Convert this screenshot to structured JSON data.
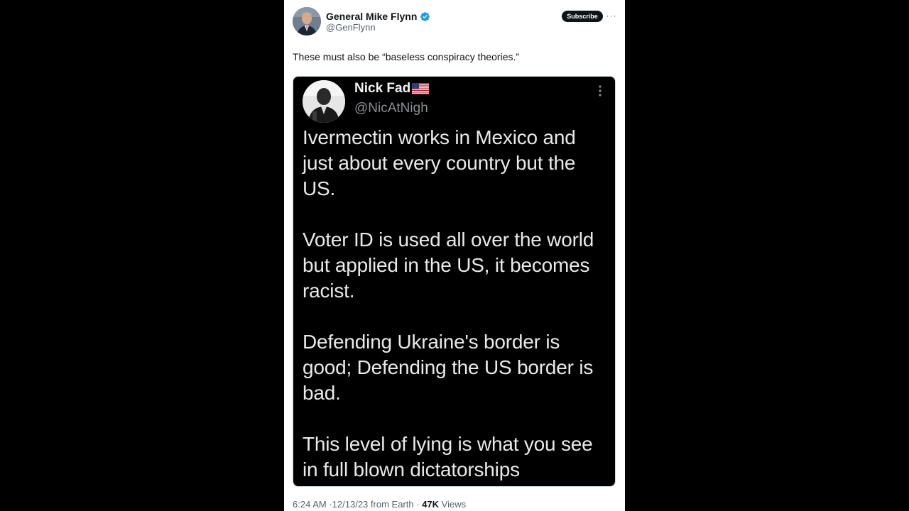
{
  "tweet": {
    "author_name": "General Mike Flynn",
    "author_handle": "@GenFlynn",
    "verified_icon": "verified-badge-icon",
    "subscribe_label": "Subscribe",
    "more_label": "···",
    "text": "These must also be “baseless conspiracy theories.”",
    "time": "6:24 AM",
    "date": "12/13/23",
    "source": "from Earth",
    "separator": "·",
    "views_count": "47K",
    "views_label": "Views"
  },
  "embedded": {
    "name": "Nick Fad",
    "flag_icon": "us-flag-icon",
    "handle": "@NicAtNigh",
    "paragraphs": [
      "Ivermectin works in Mexico and\njust about every country but the\nUS.",
      "Voter ID is used all over the world\nbut applied in the US, it becomes\nracist.",
      "Defending Ukraine's border is\ngood; Defending the US border is\nbad.",
      "This level of lying is what you see\nin full blown dictatorships"
    ]
  },
  "colors": {
    "background": "#000000",
    "card": "#ffffff",
    "verified_blue": "#1d9bf0",
    "text_primary": "#0f1419",
    "text_secondary": "#536471"
  }
}
